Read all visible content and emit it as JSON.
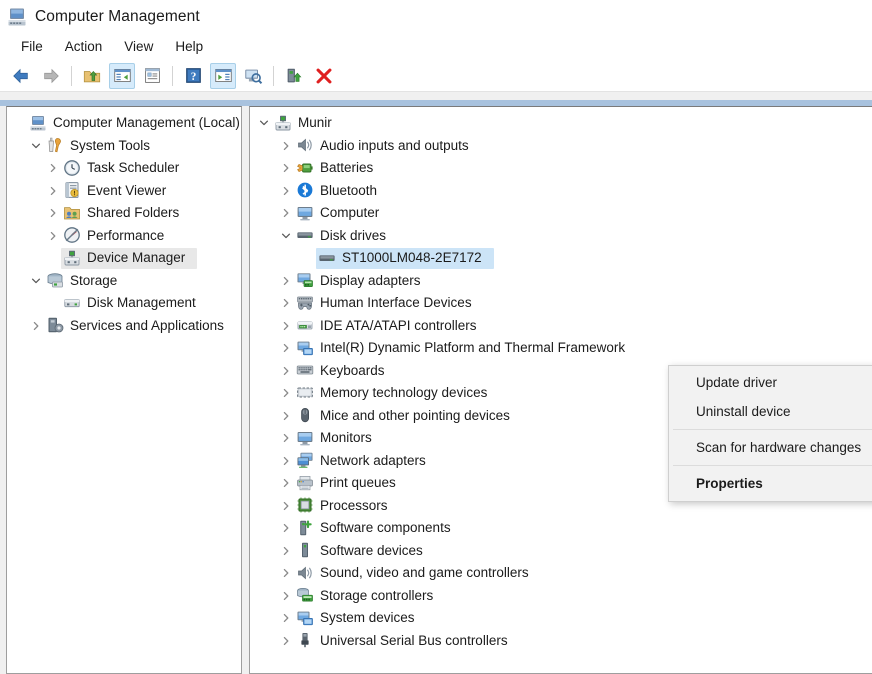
{
  "window": {
    "title": "Computer Management",
    "icon": "computer-management-icon"
  },
  "menubar": {
    "items": [
      {
        "label": "File"
      },
      {
        "label": "Action"
      },
      {
        "label": "View"
      },
      {
        "label": "Help"
      }
    ]
  },
  "toolbar": {
    "buttons": [
      {
        "name": "back-button",
        "icon": "back-arrow-icon",
        "active": false
      },
      {
        "name": "forward-button",
        "icon": "forward-arrow-icon",
        "active": false
      },
      {
        "name": "up-one-level-button",
        "icon": "folder-up-icon",
        "active": false
      },
      {
        "name": "show-hide-console-tree-button",
        "icon": "console-tree-icon",
        "active": true
      },
      {
        "name": "properties-button",
        "icon": "properties-window-icon",
        "active": false
      },
      {
        "name": "help-button",
        "icon": "question-mark-icon",
        "active": false
      },
      {
        "name": "show-hide-action-pane-button",
        "icon": "action-pane-icon",
        "active": true
      },
      {
        "name": "scan-for-hardware-changes-button",
        "icon": "monitor-search-icon",
        "active": false
      },
      {
        "name": "update-driver-button",
        "icon": "device-update-icon",
        "active": false
      },
      {
        "name": "uninstall-device-button",
        "icon": "red-x-icon",
        "active": false
      }
    ]
  },
  "console_tree": {
    "items": [
      {
        "label": "Computer Management (Local)",
        "icon": "computer-management-icon",
        "indent": 0,
        "expander": "none",
        "selected": false
      },
      {
        "label": "System Tools",
        "icon": "system-tools-icon",
        "indent": 1,
        "expander": "expanded",
        "selected": false
      },
      {
        "label": "Task Scheduler",
        "icon": "clock-icon",
        "indent": 2,
        "expander": "collapsed",
        "selected": false
      },
      {
        "label": "Event Viewer",
        "icon": "event-viewer-icon",
        "indent": 2,
        "expander": "collapsed",
        "selected": false
      },
      {
        "label": "Shared Folders",
        "icon": "shared-folders-icon",
        "indent": 2,
        "expander": "collapsed",
        "selected": false
      },
      {
        "label": "Performance",
        "icon": "performance-icon",
        "indent": 2,
        "expander": "collapsed",
        "selected": false
      },
      {
        "label": "Device Manager",
        "icon": "device-manager-icon",
        "indent": 2,
        "expander": "none",
        "selected": true
      },
      {
        "label": "Storage",
        "icon": "storage-icon",
        "indent": 1,
        "expander": "expanded",
        "selected": false
      },
      {
        "label": "Disk Management",
        "icon": "disk-management-icon",
        "indent": 2,
        "expander": "none",
        "selected": false
      },
      {
        "label": "Services and Applications",
        "icon": "services-applications-icon",
        "indent": 1,
        "expander": "collapsed",
        "selected": false
      }
    ]
  },
  "device_tree": {
    "items": [
      {
        "label": "Munir",
        "icon": "device-manager-icon",
        "indent": 0,
        "expander": "expanded",
        "selected": false
      },
      {
        "label": "Audio inputs and outputs",
        "icon": "speaker-icon",
        "indent": 1,
        "expander": "collapsed",
        "selected": false
      },
      {
        "label": "Batteries",
        "icon": "battery-icon",
        "indent": 1,
        "expander": "collapsed",
        "selected": false
      },
      {
        "label": "Bluetooth",
        "icon": "bluetooth-icon",
        "indent": 1,
        "expander": "collapsed",
        "selected": false
      },
      {
        "label": "Computer",
        "icon": "monitor-icon",
        "indent": 1,
        "expander": "collapsed",
        "selected": false
      },
      {
        "label": "Disk drives",
        "icon": "disk-drive-icon",
        "indent": 1,
        "expander": "expanded",
        "selected": false
      },
      {
        "label": "ST1000LM048-2E7172",
        "icon": "disk-drive-icon",
        "indent": 2,
        "expander": "none",
        "selected": true
      },
      {
        "label": "Display adapters",
        "icon": "display-adapter-icon",
        "indent": 1,
        "expander": "collapsed",
        "selected": false
      },
      {
        "label": "Human Interface Devices",
        "icon": "hid-gamepad-icon",
        "indent": 1,
        "expander": "collapsed",
        "selected": false
      },
      {
        "label": "IDE ATA/ATAPI controllers",
        "icon": "ide-controller-icon",
        "indent": 1,
        "expander": "collapsed",
        "selected": false
      },
      {
        "label": "Intel(R) Dynamic Platform and Thermal Framework",
        "icon": "system-device-icon",
        "indent": 1,
        "expander": "collapsed",
        "selected": false
      },
      {
        "label": "Keyboards",
        "icon": "keyboard-icon",
        "indent": 1,
        "expander": "collapsed",
        "selected": false
      },
      {
        "label": "Memory technology devices",
        "icon": "memory-icon",
        "indent": 1,
        "expander": "collapsed",
        "selected": false
      },
      {
        "label": "Mice and other pointing devices",
        "icon": "mouse-icon",
        "indent": 1,
        "expander": "collapsed",
        "selected": false
      },
      {
        "label": "Monitors",
        "icon": "monitor-icon",
        "indent": 1,
        "expander": "collapsed",
        "selected": false
      },
      {
        "label": "Network adapters",
        "icon": "network-adapter-icon",
        "indent": 1,
        "expander": "collapsed",
        "selected": false
      },
      {
        "label": "Print queues",
        "icon": "printer-icon",
        "indent": 1,
        "expander": "collapsed",
        "selected": false
      },
      {
        "label": "Processors",
        "icon": "processor-icon",
        "indent": 1,
        "expander": "collapsed",
        "selected": false
      },
      {
        "label": "Software components",
        "icon": "software-component-icon",
        "indent": 1,
        "expander": "collapsed",
        "selected": false
      },
      {
        "label": "Software devices",
        "icon": "software-device-icon",
        "indent": 1,
        "expander": "collapsed",
        "selected": false
      },
      {
        "label": "Sound, video and game controllers",
        "icon": "speaker-icon",
        "indent": 1,
        "expander": "collapsed",
        "selected": false
      },
      {
        "label": "Storage controllers",
        "icon": "storage-controller-icon",
        "indent": 1,
        "expander": "collapsed",
        "selected": false
      },
      {
        "label": "System devices",
        "icon": "system-device-icon",
        "indent": 1,
        "expander": "collapsed",
        "selected": false
      },
      {
        "label": "Universal Serial Bus controllers",
        "icon": "usb-icon",
        "indent": 1,
        "expander": "collapsed",
        "selected": false
      }
    ]
  },
  "context_menu": {
    "items": [
      {
        "label": "Update driver",
        "bold": false,
        "separator_after": false
      },
      {
        "label": "Uninstall device",
        "bold": false,
        "separator_after": true
      },
      {
        "label": "Scan for hardware changes",
        "bold": false,
        "separator_after": true
      },
      {
        "label": "Properties",
        "bold": true,
        "separator_after": false
      }
    ]
  },
  "colors": {
    "selection_active": "#cce4f7",
    "selection_inactive": "#e8e8e8",
    "band_blue": "#a8c2de",
    "toolbar_active": "#d6ebfb",
    "text": "#1b1b1b",
    "chevron": "#767676"
  }
}
